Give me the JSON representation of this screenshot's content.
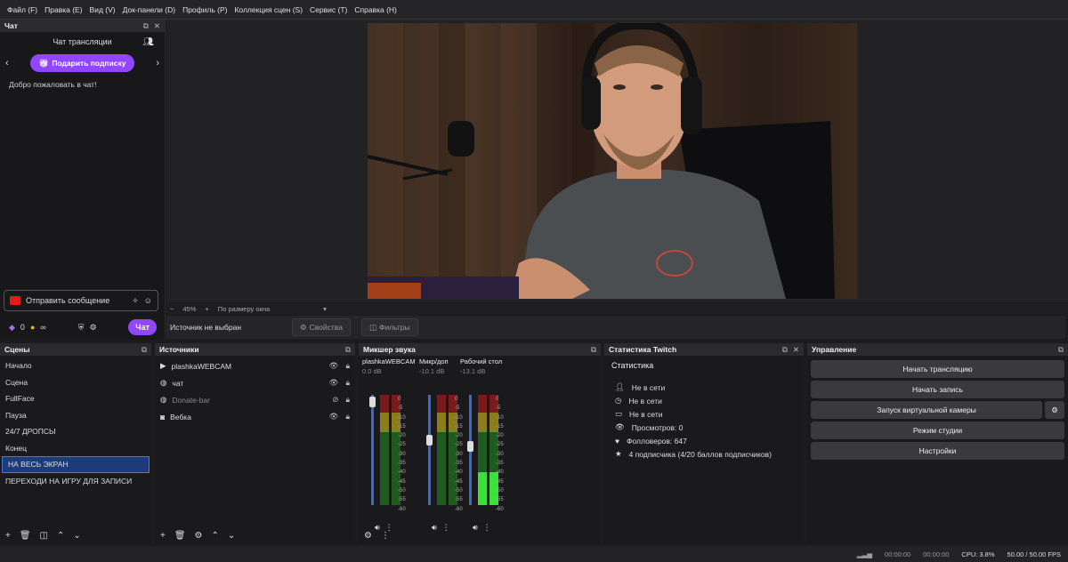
{
  "menu": [
    "Файл (F)",
    "Правка (E)",
    "Вид (V)",
    "Док-панели (D)",
    "Профиль (P)",
    "Коллекция сцен (S)",
    "Сервис (T)",
    "Справка (H)"
  ],
  "chat": {
    "dock_title": "Чат",
    "title": "Чат трансляции",
    "gift_button": "Подарить подписку",
    "welcome": "Добро пожаловать в чат!",
    "send_placeholder": "Отправить сообщение",
    "points": "0",
    "infinity": "∞",
    "chat_button": "Чат",
    "accent": "#9147ff"
  },
  "preview": {
    "zoom": "45%",
    "fit_label": "По размеру окна",
    "no_source": "Источник не выбран",
    "properties": "Свойства",
    "filters": "Фильтры"
  },
  "scenes": {
    "title": "Сцены",
    "items": [
      "Начало",
      "Сцена",
      "FullFace",
      "Пауза",
      "24/7 ДРОПСЫ",
      "Конец",
      "НА ВЕСЬ ЭКРАН",
      "ПЕРЕХОДИ НА ИГРУ ДЛЯ ЗАПИСИ"
    ],
    "selected_index": 6
  },
  "sources": {
    "title": "Источники",
    "items": [
      {
        "name": "plashkaWEBCAM",
        "icon": "play-icon",
        "visible": true
      },
      {
        "name": "чат",
        "icon": "globe-icon",
        "visible": true
      },
      {
        "name": "Donate-bar",
        "icon": "globe-icon",
        "visible": false
      },
      {
        "name": "Вебка",
        "icon": "camera-icon",
        "visible": true
      }
    ]
  },
  "mixer": {
    "title": "Микшер звука",
    "channels": [
      {
        "name": "plashkaWEBCAM",
        "db": "0.0 dB",
        "level": 0.0,
        "fader": 0.98
      },
      {
        "name": "Микр/доп",
        "db": "-10.1 dB",
        "level": 0.0,
        "fader": 0.6
      },
      {
        "name": "Рабочий стол",
        "db": "-13.1 dB",
        "level": 0.3,
        "fader": 0.54
      }
    ],
    "scale": [
      "0",
      "-5",
      "-10",
      "-15",
      "-20",
      "-25",
      "-30",
      "-35",
      "-40",
      "-45",
      "-50",
      "-55",
      "-60"
    ]
  },
  "twitch": {
    "title": "Статистика Twitch",
    "heading": "Статистика",
    "rows": [
      {
        "icon": "user-icon",
        "text": "Не в сети"
      },
      {
        "icon": "clock-icon",
        "text": "Не в сети"
      },
      {
        "icon": "video-icon",
        "text": "Не в сети"
      },
      {
        "icon": "eye-icon",
        "text": "Просмотров: 0"
      },
      {
        "icon": "heart-icon",
        "text": "Фолловеров: 647"
      },
      {
        "icon": "star-icon",
        "text": "4 подписчика (4/20 баллов подписчиков)"
      }
    ]
  },
  "controls": {
    "title": "Управление",
    "buttons": [
      "Начать трансляцию",
      "Начать запись",
      "Запуск виртуальной камеры",
      "Режим студии",
      "Настройки"
    ]
  },
  "status": {
    "stream_time": "00:00:00",
    "record_time": "00:00:00",
    "cpu": "CPU: 3.8%",
    "fps": "50.00 / 50.00 FPS"
  }
}
